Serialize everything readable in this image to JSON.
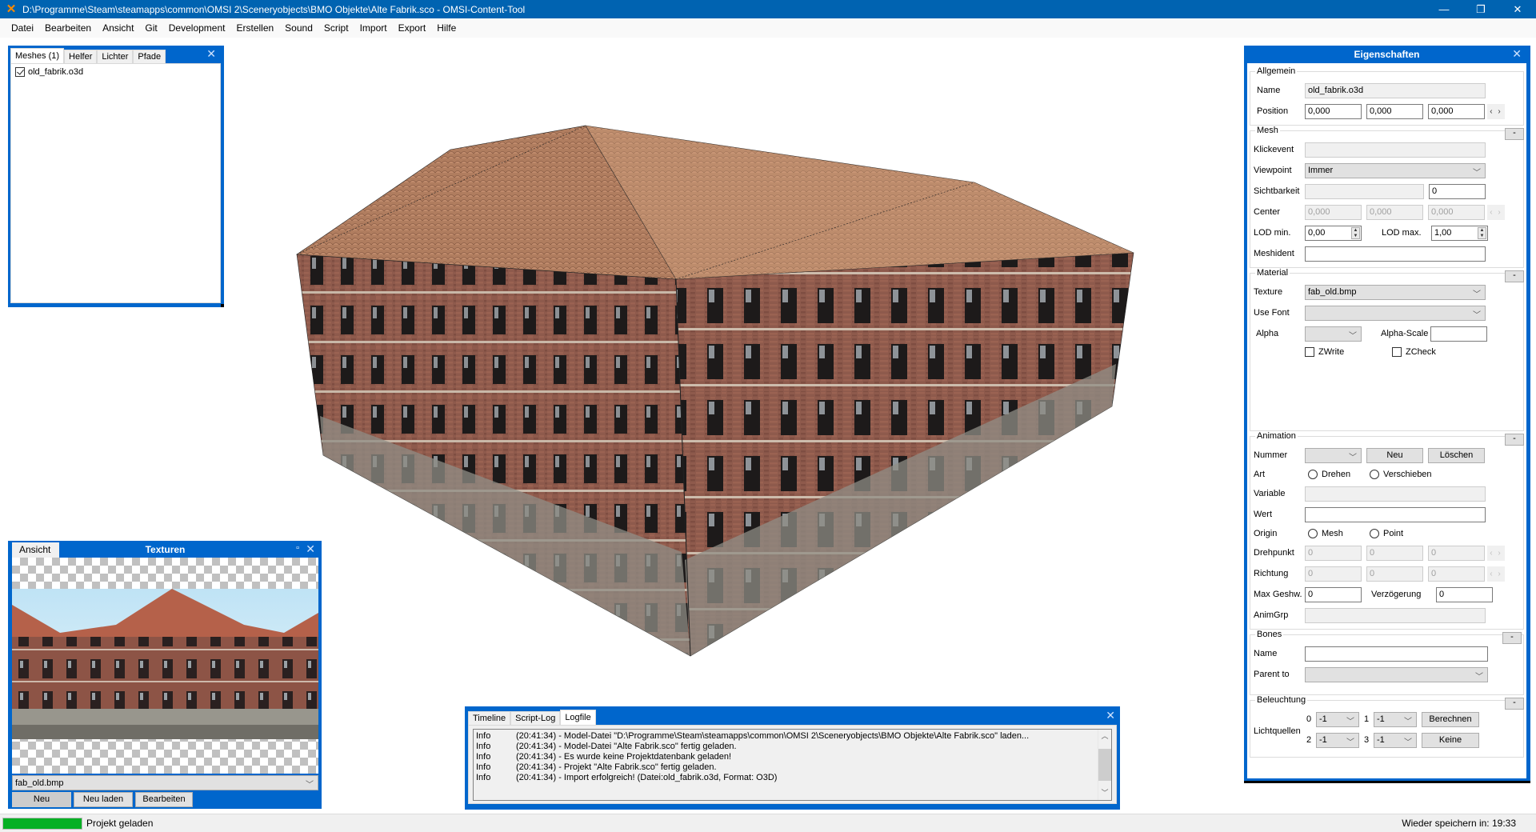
{
  "window": {
    "title": "D:\\Programme\\Steam\\steamapps\\common\\OMSI 2\\Sceneryobjects\\BMO Objekte\\Alte Fabrik.sco - OMSI-Content-Tool",
    "minimize": "—",
    "maximize": "❐",
    "close": "✕"
  },
  "menu": [
    "Datei",
    "Bearbeiten",
    "Ansicht",
    "Git",
    "Development",
    "Erstellen",
    "Sound",
    "Script",
    "Import",
    "Export",
    "Hilfe"
  ],
  "mesh_panel": {
    "tabs": [
      "Meshes (1)",
      "Helfer",
      "Lichter",
      "Pfade"
    ],
    "active_tab": "Meshes (1)",
    "close": "✕",
    "items": [
      {
        "label": "old_fabrik.o3d",
        "checked": true
      }
    ]
  },
  "texture_panel": {
    "title": "Texturen",
    "view_tab": "Ansicht",
    "float_icon": "▫",
    "close": "✕",
    "selected_texture": "fab_old.bmp",
    "buttons": {
      "new": "Neu",
      "reload": "Neu laden",
      "edit": "Bearbeiten"
    }
  },
  "log_panel": {
    "tabs": [
      "Timeline",
      "Script-Log",
      "Logfile"
    ],
    "active_tab": "Logfile",
    "close": "✕",
    "entries": [
      {
        "level": "Info",
        "message": "(20:41:34) - Model-Datei \"D:\\Programme\\Steam\\steamapps\\common\\OMSI 2\\Sceneryobjects\\BMO Objekte\\Alte Fabrik.sco\" laden..."
      },
      {
        "level": "Info",
        "message": "(20:41:34) - Model-Datei \"Alte Fabrik.sco\" fertig geladen."
      },
      {
        "level": "Info",
        "message": "(20:41:34) - Es wurde keine Projektdatenbank geladen!"
      },
      {
        "level": "Info",
        "message": "(20:41:34) - Projekt \"Alte Fabrik.sco\" fertig geladen."
      },
      {
        "level": "Info",
        "message": "(20:41:34) - Import erfolgreich! (Datei:old_fabrik.o3d, Format: O3D)"
      }
    ]
  },
  "properties": {
    "title": "Eigenschaften",
    "close": "✕",
    "collapse": "-",
    "allgemein": {
      "legend": "Allgemein",
      "name_label": "Name",
      "name_value": "old_fabrik.o3d",
      "position_label": "Position",
      "position": [
        "0,000",
        "0,000",
        "0,000"
      ],
      "arrows": "‹ ›"
    },
    "mesh": {
      "legend": "Mesh",
      "klickevent_label": "Klickevent",
      "klickevent_value": "",
      "viewpoint_label": "Viewpoint",
      "viewpoint_value": "Immer",
      "sichtbarkeit_label": "Sichtbarkeit",
      "sichtbarkeit_value": "",
      "sichtbarkeit_num": "0",
      "center_label": "Center",
      "center": [
        "0,000",
        "0,000",
        "0,000"
      ],
      "lodmin_label": "LOD min.",
      "lodmin_value": "0,00",
      "lodmax_label": "LOD max.",
      "lodmax_value": "1,00",
      "meshident_label": "Meshident",
      "meshident_value": ""
    },
    "material": {
      "legend": "Material",
      "texture_label": "Texture",
      "texture_value": "fab_old.bmp",
      "usefont_label": "Use Font",
      "usefont_value": "",
      "alpha_label": "Alpha",
      "alpha_value": "",
      "alphascale_label": "Alpha-Scale",
      "alphascale_value": "",
      "zwrite_label": "ZWrite",
      "zwrite_checked": false,
      "zcheck_label": "ZCheck",
      "zcheck_checked": false
    },
    "animation": {
      "legend": "Animation",
      "nummer_label": "Nummer",
      "nummer_value": "",
      "new_button": "Neu",
      "delete_button": "Löschen",
      "art_label": "Art",
      "art_options": [
        "Drehen",
        "Verschieben"
      ],
      "variable_label": "Variable",
      "variable_value": "",
      "wert_label": "Wert",
      "wert_value": "",
      "origin_label": "Origin",
      "origin_options": [
        "Mesh",
        "Point"
      ],
      "drehpunkt_label": "Drehpunkt",
      "drehpunkt": [
        "0",
        "0",
        "0"
      ],
      "richtung_label": "Richtung",
      "richtung": [
        "0",
        "0",
        "0"
      ],
      "maxgeshw_label": "Max Geshw.",
      "maxgeshw_value": "0",
      "verzoegerung_label": "Verzögerung",
      "verzoegerung_value": "0",
      "animgrp_label": "AnimGrp",
      "animgrp_value": ""
    },
    "bones": {
      "legend": "Bones",
      "name_label": "Name",
      "name_value": "",
      "parent_label": "Parent to",
      "parent_value": ""
    },
    "beleuchtung": {
      "legend": "Beleuchtung",
      "lichtquellen_label": "Lichtquellen",
      "slots": [
        {
          "idx": "0",
          "value": "-1"
        },
        {
          "idx": "1",
          "value": "-1"
        },
        {
          "idx": "2",
          "value": "-1"
        },
        {
          "idx": "3",
          "value": "-1"
        }
      ],
      "calc_button": "Berechnen",
      "none_button": "Keine"
    }
  },
  "statusbar": {
    "progress": 1.0,
    "progress_color": "#06b025",
    "status": "Projekt geladen",
    "autosave": "Wieder speichern in: 19:33"
  },
  "colors": {
    "accent": "#0066cc",
    "titlebar": "#0063b1"
  }
}
